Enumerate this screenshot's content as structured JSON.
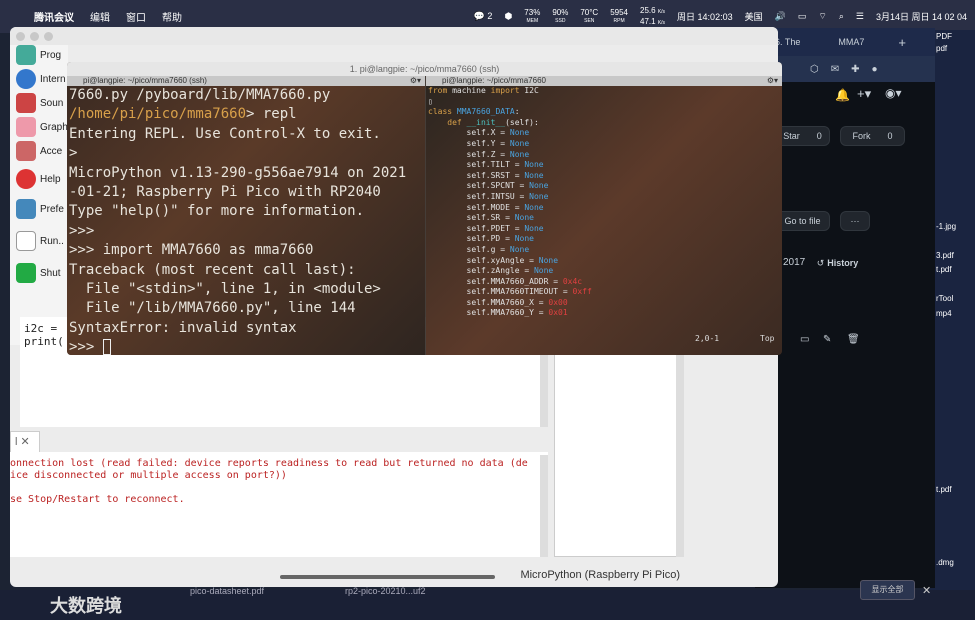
{
  "menubar": {
    "app": "腾讯会议",
    "items": [
      "编辑",
      "窗口",
      "帮助"
    ],
    "notif": "2",
    "cpu": "73%",
    "cpu_lbl": "MEM",
    "ssd": "90%",
    "ssd_lbl": "SSD",
    "temp": "70°C",
    "temp_lbl": "SEN",
    "rpm": "5954",
    "rpm_lbl": "RPM",
    "net_up": "25.6",
    "net_down": "47.1",
    "net_unit": "K/s",
    "clock": "周日 14:02:03",
    "lang": "美国",
    "date": "3月14日 周日 14 02 04"
  },
  "desktop_files": [
    "PDF",
    "pdf",
    "-1.jpg",
    "3.pdf",
    "t.pdf",
    "rTool",
    "mp4",
    "t.pdf",
    ".dmg"
  ],
  "chrome": {
    "tab1": "6. The",
    "tab2": "MMA7",
    "star": "Star",
    "star_count": "0",
    "fork": "Fork",
    "fork_count": "0",
    "goto": "Go to file",
    "year": "2017",
    "history": "History"
  },
  "thonny": {
    "sidebar": [
      "Prog",
      "Intern",
      "Soun",
      "Graph",
      "Acce",
      "Help",
      "Prefe",
      "Run..",
      "Shut"
    ],
    "editor_lines": [
      "i2c =",
      "print("
    ],
    "shell_tab": "l ✕",
    "shell_lines": [
      "onnection lost (read failed: device reports readiness to read but returned no data (de",
      "ice disconnected or multiple access on port?))",
      "",
      "se Stop/Restart to reconnect."
    ],
    "status": "MicroPython (Raspberry Pi Pico)"
  },
  "terminal": {
    "title": "1. pi@langpie: ~/pico/mma7660 (ssh)",
    "left_header": "pi@langpie: ~/pico/mma7660 (ssh)",
    "right_header": "pi@langpie: ~/pico/mma7660",
    "left_lines": [
      "7660.py /pyboard/lib/MMA7660.py",
      "/home/pi/pico/mma7660> repl",
      "Entering REPL. Use Control-X to exit.",
      ">",
      "MicroPython v1.13-290-g556ae7914 on 2021",
      "-01-21; Raspberry Pi Pico with RP2040",
      "Type \"help()\" for more information.",
      ">>>",
      ">>> import MMA7660 as mma7660",
      "Traceback (most recent call last):",
      "  File \"<stdin>\", line 1, in <module>",
      "  File \"/lib/MMA7660.py\", line 144",
      "SyntaxError: invalid syntax",
      ">>> "
    ],
    "vim_pos": "2,0-1",
    "vim_top": "Top"
  },
  "taskbar": {
    "show_all": "显示全部",
    "watermark": "大数跨境",
    "file1": "pico-datasheet.pdf",
    "file2": "rp2-pico-20210...uf2"
  }
}
